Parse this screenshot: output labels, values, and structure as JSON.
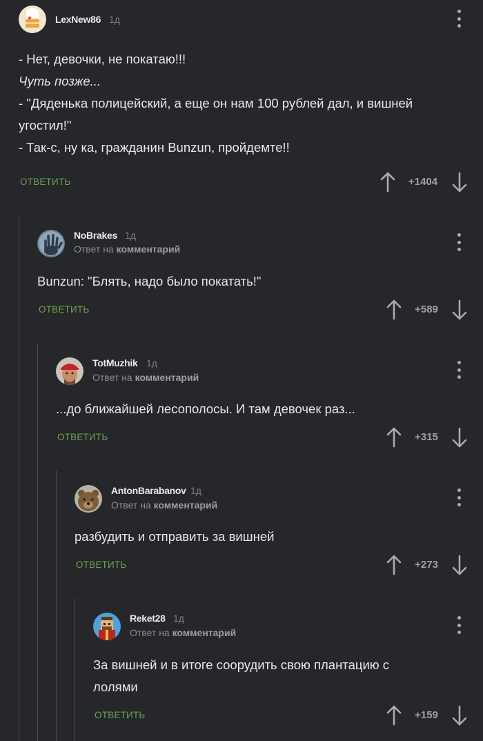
{
  "comments": [
    {
      "username": "LexNew86",
      "time": "1д",
      "reply_prefix": "",
      "reply_link": "",
      "lines": [
        "- Нет, девочки, не покатаю!!!",
        "Чуть позже...",
        "- \"Дяденька полицейский, а еще он нам 100 рублей дал, и вишней",
        "угостил!\"",
        "- Так-с, ну ка, гражданин Bunzun, пройдемте!!"
      ],
      "reply_label": "ОТВЕТИТЬ",
      "rating": "+1404",
      "avatar_icon": "chef-cake-avatar-icon"
    },
    {
      "username": "NoBrakes",
      "time": "1д",
      "reply_prefix": "Ответ на",
      "reply_link": "комментарий",
      "lines": [
        "Bunzun: \"Блять, надо было покатать!\""
      ],
      "reply_label": "ОТВЕТИТЬ",
      "rating": "+589",
      "avatar_icon": "hand-avatar-icon"
    },
    {
      "username": "TotMuzhik",
      "time": "1д",
      "reply_prefix": "Ответ на",
      "reply_link": "комментарий",
      "lines": [
        "...до ближайшей лесополосы. И там девочек раз..."
      ],
      "reply_label": "ОТВЕТИТЬ",
      "rating": "+315",
      "avatar_icon": "man-bandana-avatar-icon"
    },
    {
      "username": "AntonBarabanov",
      "time": "1д",
      "reply_prefix": "Ответ на",
      "reply_link": "комментарий",
      "lines": [
        "разбудить и отправить за вишней"
      ],
      "reply_label": "ОТВЕТИТЬ",
      "rating": "+273",
      "avatar_icon": "bear-avatar-icon"
    },
    {
      "username": "Reket28",
      "time": "1д",
      "reply_prefix": "Ответ на",
      "reply_link": "комментарий",
      "lines": [
        "За вишней и в итоге соорудить свою плантацию с",
        "лолями"
      ],
      "reply_label": "ОТВЕТИТЬ",
      "rating": "+159",
      "avatar_icon": "pixel-man-avatar-icon"
    }
  ],
  "colors": {
    "background": "#25272b",
    "accent_green": "#6ea34a",
    "text": "#e7e8ea",
    "muted": "#7b7d82",
    "thread_line": "#4a4c50"
  }
}
